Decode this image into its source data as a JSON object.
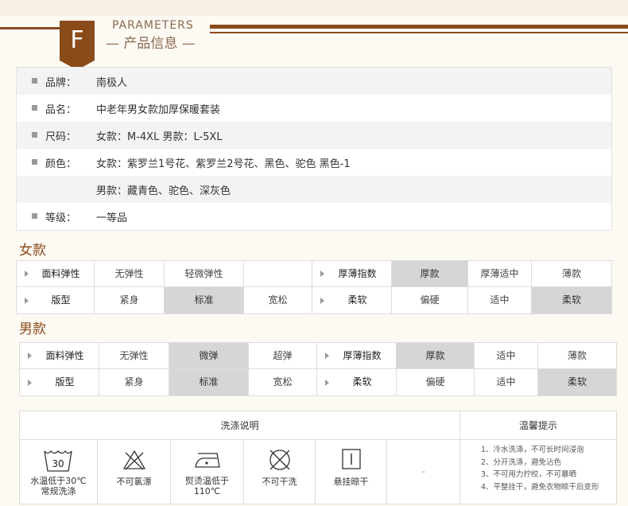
{
  "header": {
    "badge_letter": "F",
    "title_en": "PARAMETERS",
    "title_cn": "— 产品信息 —",
    "brand_color": "#8a4b1b"
  },
  "info": [
    {
      "label": "品牌：",
      "value": "南极人"
    },
    {
      "label": "品名：",
      "value": "中老年男女款加厚保暖套装"
    },
    {
      "label": "尺码：",
      "value": "女款：M-4XL  男款：L-5XL"
    },
    {
      "label": "颜色：",
      "value": "女款：紫罗兰1号花、紫罗兰2号花、黑色、驼色  黑色-1"
    },
    {
      "label": "",
      "value": "男款：藏青色、驼色、深灰色"
    },
    {
      "label": "等级：",
      "value": "一等品"
    }
  ],
  "women": {
    "title": "女款",
    "rows": [
      {
        "label": "面料弹性",
        "opts": [
          "无弹性",
          "轻微弹性",
          ""
        ],
        "label2": "厚薄指数",
        "opts2": [
          "厚款",
          "厚薄适中",
          "薄款"
        ]
      },
      {
        "label": "版型",
        "opts": [
          "紧身",
          "标准",
          "宽松"
        ],
        "label2": "柔软",
        "opts2": [
          "偏硬",
          "适中",
          "柔软"
        ]
      }
    ],
    "selected": {
      "elasticity": "",
      "fit": "标准",
      "thickness": "厚款",
      "softness": "柔软"
    }
  },
  "men": {
    "title": "男款",
    "rows": [
      {
        "label": "面料弹性",
        "opts": [
          "无弹性",
          "微弹",
          "超弹"
        ],
        "label2": "厚薄指数",
        "opts2": [
          "厚款",
          "适中",
          "薄款"
        ]
      },
      {
        "label": "版型",
        "opts": [
          "紧身",
          "标准",
          "宽松"
        ],
        "label2": "柔软",
        "opts2": [
          "偏硬",
          "适中",
          "柔软"
        ]
      }
    ],
    "selected": {
      "elasticity": "微弹",
      "fit": "标准",
      "thickness": "厚款",
      "softness": "柔软"
    }
  },
  "care": {
    "title": "洗涤说明",
    "tips_title": "温馨提示",
    "wash_temp": "30",
    "items": [
      {
        "icon": "wash-30-icon",
        "caption": "水温低于30℃\n常规洗涤"
      },
      {
        "icon": "no-bleach-icon",
        "caption": "不可氯漂"
      },
      {
        "icon": "iron-icon",
        "caption": "熨烫温低于\n110℃"
      },
      {
        "icon": "no-dry-clean-icon",
        "caption": "不可干洗"
      },
      {
        "icon": "line-dry-icon",
        "caption": "悬挂晾干"
      },
      {
        "icon": "",
        "caption": "–"
      }
    ],
    "tips": [
      "1、冷水洗涤，不可长时间浸泡",
      "2、分开洗涤，避免沾色",
      "3、不可用力拧绞，不可暴晒",
      "4、平整挂干，避免衣物晾干后变形"
    ]
  }
}
